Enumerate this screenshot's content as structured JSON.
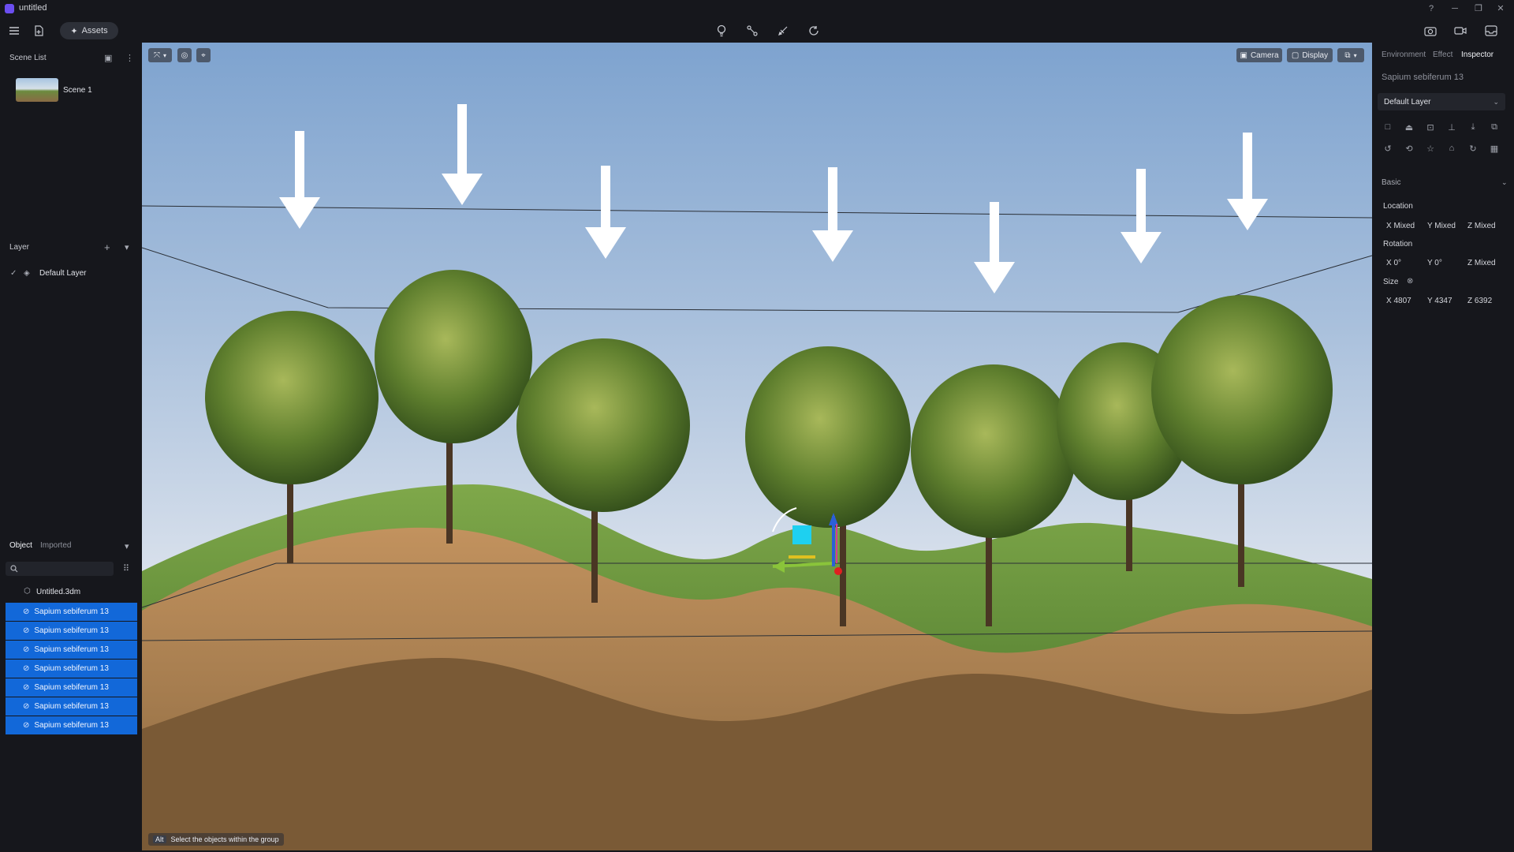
{
  "app": {
    "title": "untitled"
  },
  "toolbar": {
    "assets_label": "Assets"
  },
  "scene_list": {
    "title": "Scene List",
    "scenes": [
      {
        "label": "Scene 1"
      }
    ]
  },
  "layer": {
    "title": "Layer",
    "items": [
      {
        "label": "Default Layer",
        "checked": true
      }
    ]
  },
  "objects": {
    "tabs": [
      "Object",
      "Imported"
    ],
    "root": "Untitled.3dm",
    "items": [
      "Sapium sebiferum 13",
      "Sapium sebiferum 13",
      "Sapium sebiferum 13",
      "Sapium sebiferum 13",
      "Sapium sebiferum 13",
      "Sapium sebiferum 13",
      "Sapium sebiferum 13"
    ]
  },
  "viewport": {
    "camera_label": "Camera",
    "display_label": "Display",
    "status_key": "Alt",
    "status_text": "Select the objects within the group"
  },
  "inspector": {
    "tabs": [
      "Environment",
      "Effect",
      "Inspector"
    ],
    "active_tab": "Inspector",
    "object_name": "Sapium sebiferum 13",
    "layer_select": "Default Layer",
    "section": "Basic",
    "location": {
      "label": "Location",
      "x": "X  Mixed",
      "y": "Y  Mixed",
      "z": "Z  Mixed"
    },
    "rotation": {
      "label": "Rotation",
      "x": "X  0°",
      "y": "Y  0°",
      "z": "Z  Mixed"
    },
    "size": {
      "label": "Size",
      "x": "X  4807",
      "y": "Y  4347",
      "z": "Z  6392"
    }
  },
  "colors": {
    "accent": "#1268d9",
    "panel_bg": "#16171c",
    "logo": "#6b4ef0"
  }
}
